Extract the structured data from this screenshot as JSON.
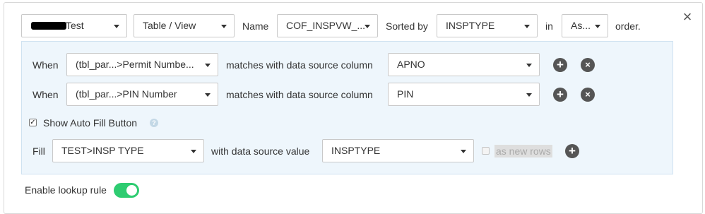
{
  "header": {
    "source_select": "Test",
    "type_select": "Table / View",
    "name_label": "Name",
    "name_select": "COF_INSPVW_...",
    "sorted_label": "Sorted by",
    "sort_select": "INSPTYPE",
    "in_label": "in",
    "order_select": "As...",
    "order_suffix": "order."
  },
  "close_icon": "×",
  "conditions": [
    {
      "when_label": "When",
      "field": "(tbl_par...>Permit Numbe...",
      "matches_text": "matches with data source column",
      "column": "APNO"
    },
    {
      "when_label": "When",
      "field": "(tbl_par...>PIN Number",
      "matches_text": "matches with data source column",
      "column": "PIN"
    }
  ],
  "icons": {
    "add": "+",
    "remove": "×",
    "check": "✓",
    "help": "?"
  },
  "autofill": {
    "label": "Show Auto Fill Button",
    "checked": true
  },
  "fill": {
    "label": "Fill",
    "target": "TEST>INSP TYPE",
    "value_text": "with data source value",
    "source": "INSPTYPE",
    "new_rows_label": "as new rows",
    "new_rows_checked": false
  },
  "lookup": {
    "label": "Enable lookup rule",
    "enabled": true
  },
  "colors": {
    "toggle_on": "#2ecc71",
    "panel_bg": "#eef6fc",
    "icon_button": "#555555"
  }
}
